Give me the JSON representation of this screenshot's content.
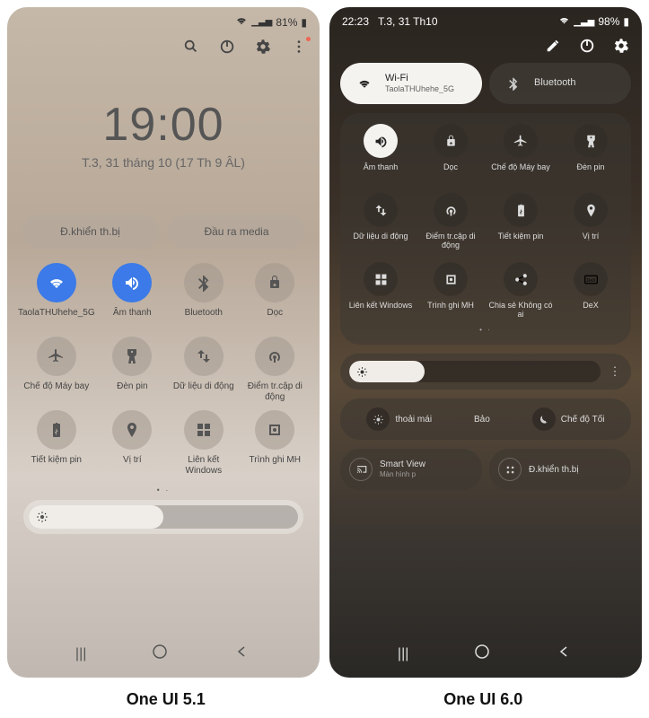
{
  "captions": {
    "left": "One UI 5.1",
    "right": "One UI 6.0"
  },
  "p51": {
    "status": {
      "battery": "81%"
    },
    "clock": {
      "time": "19:00",
      "date": "T.3, 31 tháng 10 (17 Th 9 ÂL)"
    },
    "pills": {
      "devices": "Đ.khiển th.bị",
      "media": "Đầu ra media"
    },
    "tiles": [
      {
        "lbl": "TaolaTHUhehe_5G",
        "on": true,
        "icon": "wifi"
      },
      {
        "lbl": "Âm thanh",
        "on": true,
        "icon": "sound"
      },
      {
        "lbl": "Bluetooth",
        "on": false,
        "icon": "bt"
      },
      {
        "lbl": "Dọc",
        "on": false,
        "icon": "lock"
      },
      {
        "lbl": "Chế độ Máy bay",
        "on": false,
        "icon": "plane"
      },
      {
        "lbl": "Đèn pin",
        "on": false,
        "icon": "flash"
      },
      {
        "lbl": "Dữ liệu di động",
        "on": false,
        "icon": "data"
      },
      {
        "lbl": "Điểm tr.cập di động",
        "on": false,
        "icon": "hotspot"
      },
      {
        "lbl": "Tiết kiệm pin",
        "on": false,
        "icon": "batt"
      },
      {
        "lbl": "Vị trí",
        "on": false,
        "icon": "loc"
      },
      {
        "lbl": "Liên kết Windows",
        "on": false,
        "icon": "win"
      },
      {
        "lbl": "Trình ghi MH",
        "on": false,
        "icon": "rec"
      }
    ]
  },
  "p60": {
    "status": {
      "time": "22:23",
      "date": "T.3, 31 Th10",
      "battery": "98%"
    },
    "qs": {
      "wifi_t": "Wi-Fi",
      "wifi_s": "TaolaTHUhehe_5G",
      "bt": "Bluetooth"
    },
    "tiles": [
      {
        "lbl": "Âm thanh",
        "on": true,
        "icon": "sound"
      },
      {
        "lbl": "Dọc",
        "on": false,
        "icon": "lock"
      },
      {
        "lbl": "Chế độ Máy bay",
        "on": false,
        "icon": "plane"
      },
      {
        "lbl": "Đèn pin",
        "on": false,
        "icon": "flash"
      },
      {
        "lbl": "Dữ liệu di động",
        "on": false,
        "icon": "data"
      },
      {
        "lbl": "Điểm tr.cập di động",
        "on": false,
        "icon": "hotspot"
      },
      {
        "lbl": "Tiết kiệm pin",
        "on": false,
        "icon": "batt"
      },
      {
        "lbl": "Vị trí",
        "on": false,
        "icon": "loc"
      },
      {
        "lbl": "Liên kết Windows",
        "on": false,
        "icon": "win"
      },
      {
        "lbl": "Trình ghi MH",
        "on": false,
        "icon": "rec"
      },
      {
        "lbl": "Chia sẻ Không có ai",
        "on": false,
        "icon": "share"
      },
      {
        "lbl": "DeX",
        "on": false,
        "icon": "dex"
      }
    ],
    "modes": {
      "comfort": "thoải mái",
      "protect": "Bảo",
      "dark": "Chế độ Tối"
    },
    "bottom": {
      "sv": "Smart View",
      "sv_s": "Màn hình p",
      "dev": "Đ.khiển th.bị"
    }
  }
}
